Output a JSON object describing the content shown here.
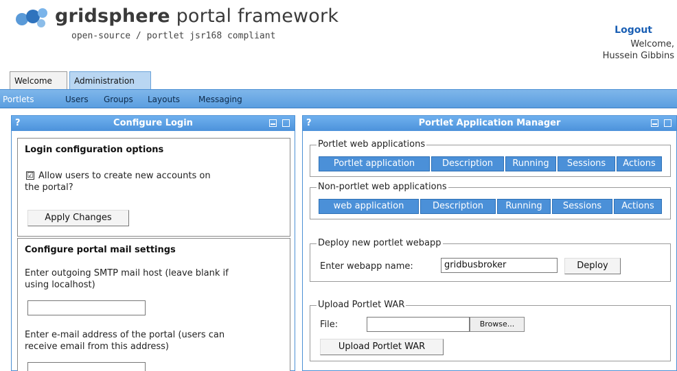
{
  "header": {
    "brand_bold": "gridsphere",
    "brand_rest": " portal framework",
    "subtitle": "open-source / portlet jsr168 compliant",
    "logout_label": "Logout",
    "welcome_line1": "Welcome,",
    "welcome_line2": "Hussein Gibbins"
  },
  "tabs": [
    {
      "label": "Welcome"
    },
    {
      "label": "Administration"
    }
  ],
  "subnav": [
    {
      "label": "Portlets"
    },
    {
      "label": "Users"
    },
    {
      "label": "Groups"
    },
    {
      "label": "Layouts"
    },
    {
      "label": "Messaging"
    }
  ],
  "left_portlet": {
    "help": "?",
    "title": "Configure Login",
    "login_section": {
      "heading": "Login configuration options",
      "checkbox_checked": "☑",
      "checkbox_label_line1": "Allow users to create new accounts on",
      "checkbox_label_line2": "the portal?",
      "apply_label": "Apply Changes"
    },
    "mail_section": {
      "heading": "Configure portal mail settings",
      "smtp_label_line1": "Enter outgoing SMTP mail host (leave blank if",
      "smtp_label_line2": "using localhost)",
      "smtp_value": "",
      "email_label_line1": "Enter e-mail address of the portal (users can",
      "email_label_line2": "receive email from this address)",
      "email_value": ""
    }
  },
  "right_portlet": {
    "help": "?",
    "title": "Portlet Application Manager",
    "portlet_webapps": {
      "legend": "Portlet web applications",
      "columns": [
        "Portlet application",
        "Description",
        "Running",
        "Sessions",
        "Actions"
      ]
    },
    "non_portlet_webapps": {
      "legend": "Non-portlet web applications",
      "columns": [
        "web application",
        "Description",
        "Running",
        "Sessions",
        "Actions"
      ]
    },
    "deploy": {
      "legend": "Deploy new portlet webapp",
      "label": "Enter webapp name:",
      "value": "gridbusbroker",
      "button": "Deploy"
    },
    "upload": {
      "legend": "Upload Portlet WAR",
      "file_label": "File:",
      "file_value": "",
      "browse": "Browse...",
      "button": "Upload Portlet WAR"
    }
  },
  "colors": {
    "accent": "#4b90d8",
    "nav_bg": "#6aa9e6",
    "link": "#1a5fb4"
  }
}
